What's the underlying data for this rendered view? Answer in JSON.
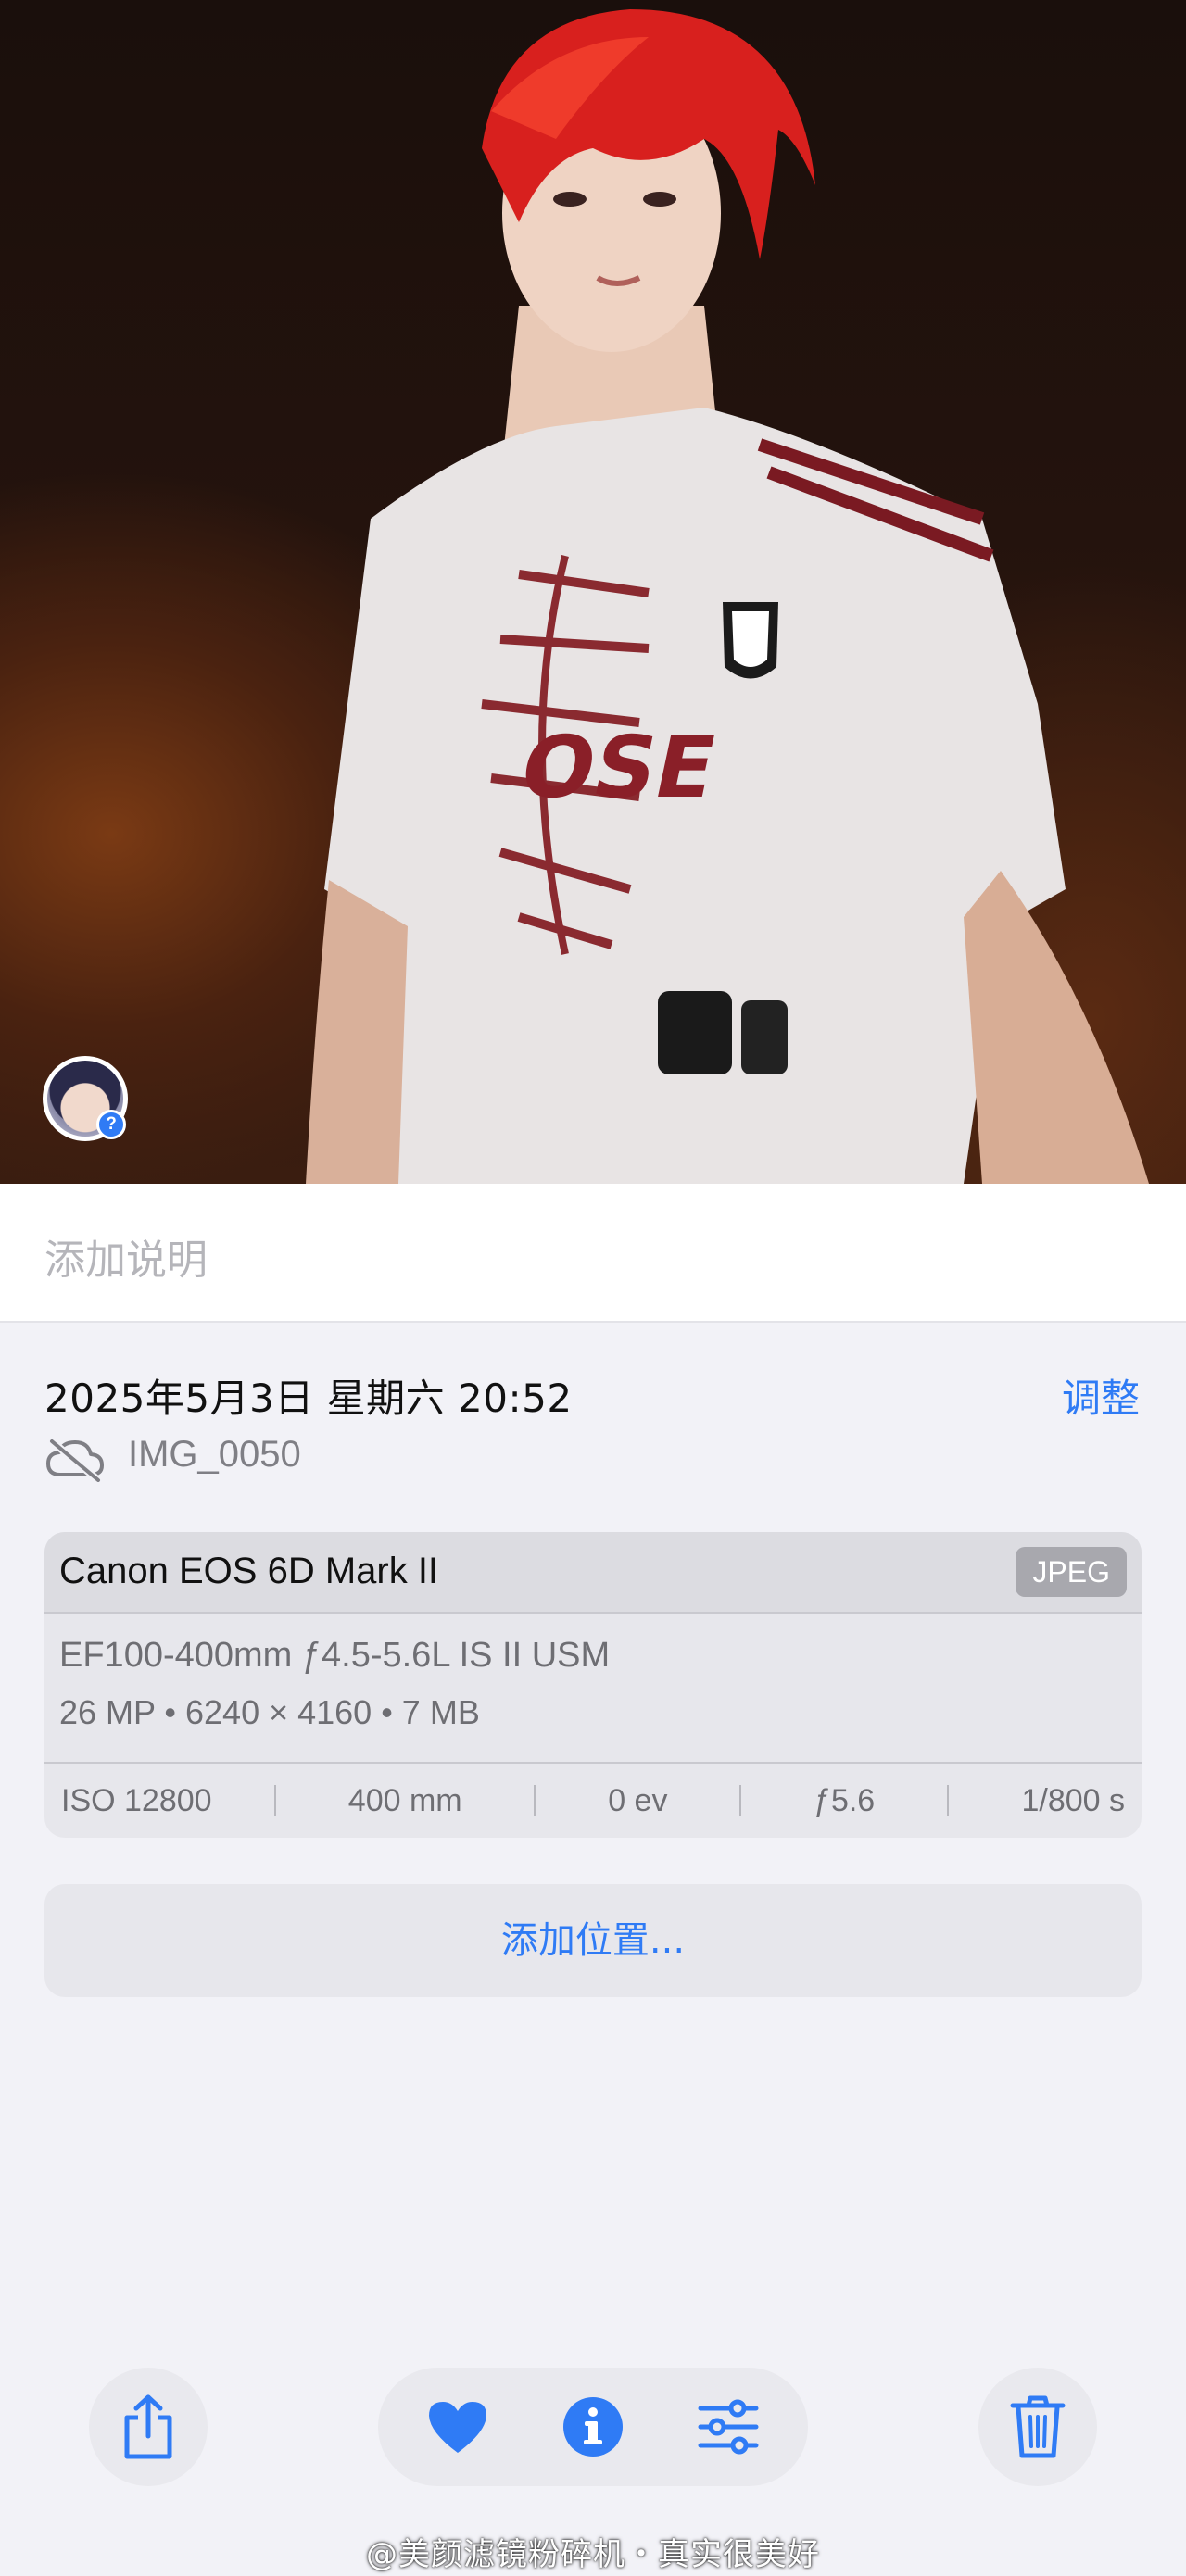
{
  "caption": {
    "placeholder": "添加说明"
  },
  "info": {
    "datetime": "2025年5月3日 星期六 20:52",
    "adjust_label": "调整",
    "filename": "IMG_0050",
    "cloud_icon": "cloud-slash-icon"
  },
  "camera": {
    "model": "Canon EOS 6D Mark II",
    "format": "JPEG",
    "lens": "EF100-400mm ƒ4.5-5.6L IS II USM",
    "specs": "26 MP • 6240 × 4160 • 7 MB",
    "exif": {
      "iso": "ISO 12800",
      "focal_length": "400 mm",
      "exposure_bias": "0 ev",
      "aperture": "ƒ5.6",
      "shutter": "1/800 s"
    }
  },
  "location": {
    "add_label": "添加位置..."
  },
  "people_badge": {
    "mark": "?"
  },
  "toolbar": {
    "share_icon": "share-icon",
    "favorite_icon": "heart-icon",
    "info_icon": "info-icon",
    "edit_icon": "sliders-icon",
    "delete_icon": "trash-icon"
  },
  "watermark": "@美颜滤镜粉碎机・真实很美好",
  "colors": {
    "accent": "#2f7bf5",
    "background": "#f2f2f7",
    "card": "#e7e7ec",
    "hair": "#d8201e"
  }
}
